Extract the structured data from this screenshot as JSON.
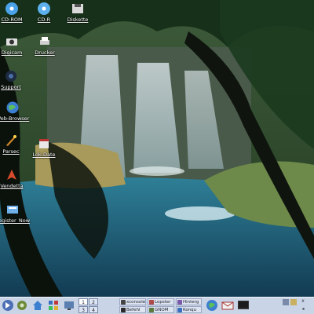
{
  "desktop": {
    "icons": [
      {
        "label": "CD-ROM",
        "icon": "cd-rom-icon"
      },
      {
        "label": "CD-R",
        "icon": "cd-r-icon"
      },
      {
        "label": "Diskette",
        "icon": "floppy-icon"
      },
      {
        "label": "Digicam",
        "icon": "camera-icon"
      },
      {
        "label": "Drucker",
        "icon": "printer-icon"
      },
      {
        "label": "Support",
        "icon": "support-icon"
      },
      {
        "label": "Web-Browser",
        "icon": "globe-icon"
      },
      {
        "label": "Parsec",
        "icon": "parsec-icon"
      },
      {
        "label": "Lok-Date",
        "icon": "lok-date-icon"
      },
      {
        "label": "Vendetta",
        "icon": "vendetta-icon"
      },
      {
        "label": "Register_Now",
        "icon": "register-icon"
      }
    ]
  },
  "taskbar": {
    "launchers": [
      {
        "icon": "kmenu-icon"
      },
      {
        "icon": "settings-icon"
      },
      {
        "icon": "home-icon"
      },
      {
        "icon": "apps-icon"
      },
      {
        "icon": "show-desktop-icon"
      }
    ],
    "pager": [
      "1",
      "2",
      "3",
      "4"
    ],
    "tasks": [
      {
        "label": "xconsole"
      },
      {
        "label": "Befehl"
      },
      {
        "label": "Lopster"
      },
      {
        "label": "GNOM"
      },
      {
        "label": "Hinterg"
      },
      {
        "label": "Konqu"
      }
    ],
    "quick_icons": [
      {
        "icon": "globe-icon"
      },
      {
        "icon": "mail-icon"
      },
      {
        "icon": "terminal-icon"
      }
    ],
    "tray": [
      {
        "icon": "tray-network-icon"
      },
      {
        "icon": "tray-clock-icon"
      },
      {
        "icon": "tray-close-icon",
        "label": "x"
      },
      {
        "icon": "tray-arrow-icon",
        "label": "◂"
      }
    ]
  },
  "colors": {
    "taskbar_bg": "#c9d4e6",
    "water": "#1f5f7a",
    "foliage": "#1b3a1e"
  }
}
